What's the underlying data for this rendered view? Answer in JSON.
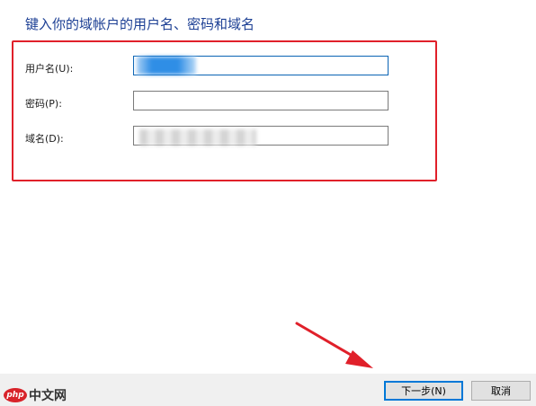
{
  "dialog": {
    "heading": "键入你的域帐户的用户名、密码和域名",
    "fields": [
      {
        "label": "用户名(U):",
        "value": "",
        "placeholder": ""
      },
      {
        "label": "密码(P):",
        "value": "",
        "placeholder": ""
      },
      {
        "label": "域名(D):",
        "value": "",
        "placeholder": ""
      }
    ]
  },
  "buttons": {
    "next_label": "下一步(N)",
    "cancel_label": "取消"
  },
  "watermark": {
    "logo_text": "php",
    "site_text": "中文网"
  },
  "colors": {
    "heading": "#1c3f94",
    "highlight_box": "#e0202a",
    "annotation_arrow": "#e0202a",
    "primary_button_border": "#0078d7",
    "footer_background": "#f0f0f0"
  },
  "icons": {
    "annotation": "red-arrow-icon"
  }
}
